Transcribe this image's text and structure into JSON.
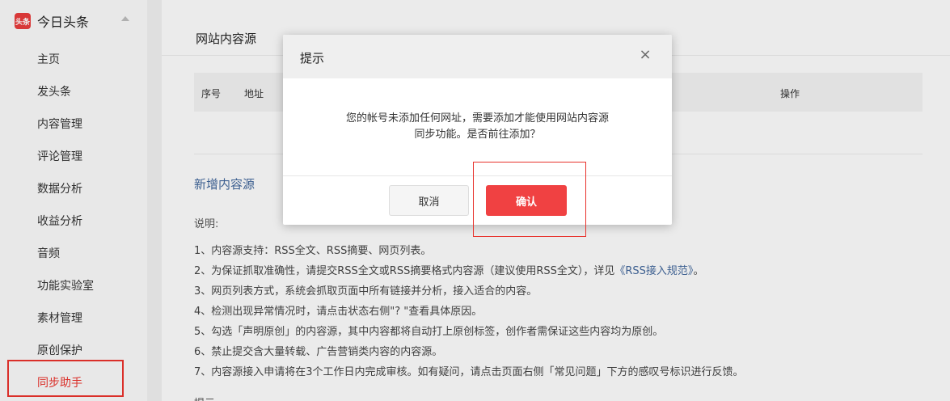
{
  "sidebar": {
    "brand_logo_text": "头条",
    "brand_name": "今日头条",
    "items": [
      {
        "label": "主页"
      },
      {
        "label": "发头条"
      },
      {
        "label": "内容管理"
      },
      {
        "label": "评论管理"
      },
      {
        "label": "数据分析"
      },
      {
        "label": "收益分析"
      },
      {
        "label": "音频"
      },
      {
        "label": "功能实验室"
      },
      {
        "label": "素材管理"
      },
      {
        "label": "原创保护"
      },
      {
        "label": "同步助手"
      }
    ],
    "active_item": "同步助手",
    "highlight_color": "#e8322c"
  },
  "main": {
    "title": "网站内容源",
    "table_headers": {
      "index": "序号",
      "address": "地址",
      "actions": "操作"
    },
    "section_title": "新增内容源",
    "note_label": "说明:",
    "notes": [
      "1、内容源支持：RSS全文、RSS摘要、网页列表。",
      "2、为保证抓取准确性，请提交RSS全文或RSS摘要格式内容源（建议使用RSS全文），详见",
      "3、网页列表方式，系统会抓取页面中所有链接并分析，接入适合的内容。",
      "4、检测出现异常情况时，请点击状态右侧\"? \"查看具体原因。",
      "5、勾选「声明原创」的内容源，其中内容都将自动打上原创标签，创作者需保证这些内容均为原创。",
      "6、禁止提交含大量转载、广告营销类内容的内容源。",
      "7、内容源接入申请将在3个工作日内完成审核。如有疑问，请点击页面右侧「常见问题」下方的感叹号标识进行反馈。"
    ],
    "note2_link": "《RSS接入规范》",
    "note2_tail": "。",
    "next_label": "提示"
  },
  "modal": {
    "title": "提示",
    "close_icon": "×",
    "body_line1": "您的帐号未添加任何网址，需要添加才能使用网站内容源",
    "body_line2": "同步功能。是否前往添加？",
    "cancel_label": "取消",
    "confirm_label": "确认",
    "confirm_color": "#f04142"
  }
}
